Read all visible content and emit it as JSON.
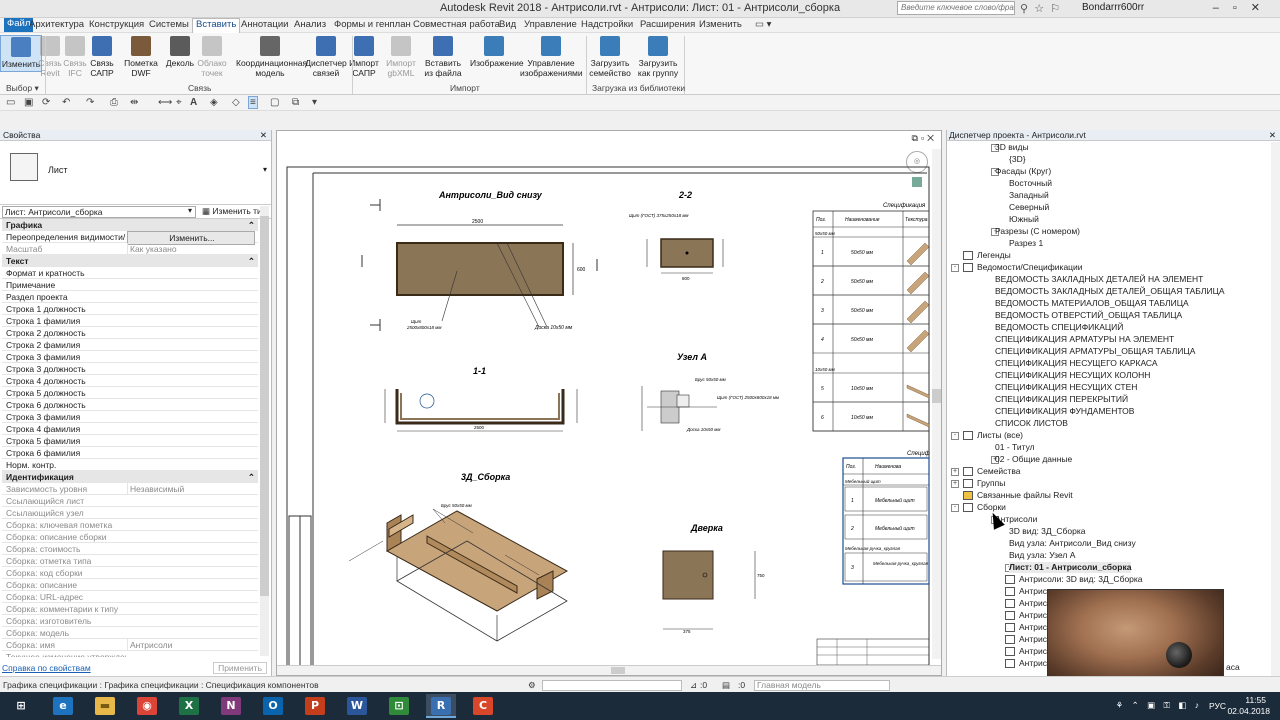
{
  "window": {
    "title": "Autodesk Revit 2018 -     Антрисоли.rvt - Антрисоли: Лист: 01 - Антрисоли_сборка",
    "search_placeholder": "Введите ключевое слово/фразу",
    "user": "Bondarrr600rr"
  },
  "menu": [
    "Файл",
    "Архитектура",
    "Конструкция",
    "Системы",
    "Вставить",
    "Аннотации",
    "Анализ",
    "Формы и генплан",
    "Совместная работа",
    "Вид",
    "Управление",
    "Надстройки",
    "Расширения",
    "Изменить"
  ],
  "menu_active": "Вставить",
  "ribbon": {
    "buttons": [
      {
        "label": "Изменить",
        "color": "#4a7fc1"
      },
      {
        "label": "Связь Revit",
        "color": "#888"
      },
      {
        "label": "Связь IFC",
        "color": "#888"
      },
      {
        "label": "Связь САПР",
        "color": "#3f6fb3"
      },
      {
        "label": "Пометка DWF",
        "color": "#7a5a3a"
      },
      {
        "label": "Деколь",
        "color": "#5b5b5b"
      },
      {
        "label": "Облако точек",
        "color": "#888"
      },
      {
        "label": "Координационная модель",
        "color": "#666"
      },
      {
        "label": "Диспетчер связей",
        "color": "#3f6fb3"
      },
      {
        "label": "Импорт САПР",
        "color": "#3f6fb3"
      },
      {
        "label": "Импорт gbXML",
        "color": "#888"
      },
      {
        "label": "Вставить из файла",
        "color": "#3f6fb3"
      },
      {
        "label": "Изображение",
        "color": "#3a7db8"
      },
      {
        "label": "Управление изображениями",
        "color": "#3a7db8"
      },
      {
        "label": "Загрузить семейство",
        "color": "#3a7db8"
      },
      {
        "label": "Загрузить как группу",
        "color": "#3a7db8"
      }
    ],
    "panels": {
      "select": "Выбор ▾",
      "link": "Связь",
      "import": "Импорт",
      "library": "Загрузка из библиотеки"
    }
  },
  "properties": {
    "header": "Свойства",
    "type_name": "Лист",
    "selector": "Лист: Антрисоли_сборка",
    "edit_type": "Изменить тип",
    "rows": [
      {
        "k": "Графика",
        "grp": true
      },
      {
        "k": "Переопределения видимости/...",
        "v": "Изменить..."
      },
      {
        "k": "Масштаб",
        "v": "Как указано",
        "dim": true
      },
      {
        "k": "Текст",
        "grp": true
      },
      {
        "k": "Формат и кратность",
        "v": ""
      },
      {
        "k": "Примечание",
        "v": ""
      },
      {
        "k": "Раздел проекта",
        "v": ""
      },
      {
        "k": "Строка 1 должность",
        "v": ""
      },
      {
        "k": "Строка 1 фамилия",
        "v": ""
      },
      {
        "k": "Строка 2 должность",
        "v": ""
      },
      {
        "k": "Строка 2 фамилия",
        "v": ""
      },
      {
        "k": "Строка 3 фамилия",
        "v": ""
      },
      {
        "k": "Строка 3 должность",
        "v": ""
      },
      {
        "k": "Строка 4 должность",
        "v": ""
      },
      {
        "k": "Строка 5 должность",
        "v": ""
      },
      {
        "k": "Строка 6 должность",
        "v": ""
      },
      {
        "k": "Строка 3 фамилия",
        "v": ""
      },
      {
        "k": "Строка 4 фамилия",
        "v": ""
      },
      {
        "k": "Строка 5 фамилия",
        "v": ""
      },
      {
        "k": "Строка 6 фамилия",
        "v": ""
      },
      {
        "k": "Норм. контр.",
        "v": ""
      },
      {
        "k": "Идентификация",
        "grp": true
      },
      {
        "k": "Зависимость уровня",
        "v": "Независимый",
        "dim": true
      },
      {
        "k": "Ссылающийся лист",
        "v": "",
        "dim": true
      },
      {
        "k": "Ссылающийся узел",
        "v": "",
        "dim": true
      },
      {
        "k": "Сборка: ключевая пометка",
        "v": "",
        "dim": true
      },
      {
        "k": "Сборка: описание сборки",
        "v": "",
        "dim": true
      },
      {
        "k": "Сборка: стоимость",
        "v": "",
        "dim": true
      },
      {
        "k": "Сборка: отметка типа",
        "v": "",
        "dim": true
      },
      {
        "k": "Сборка: код сборки",
        "v": "",
        "dim": true
      },
      {
        "k": "Сборка: описание",
        "v": "",
        "dim": true
      },
      {
        "k": "Сборка: URL-адрес",
        "v": "",
        "dim": true
      },
      {
        "k": "Сборка: комментарии к типу",
        "v": "",
        "dim": true
      },
      {
        "k": "Сборка: изготовитель",
        "v": "",
        "dim": true
      },
      {
        "k": "Сборка: модель",
        "v": "",
        "dim": true
      },
      {
        "k": "Сборка: имя",
        "v": "Антрисоли",
        "dim": true
      },
      {
        "k": "Текущее изменение утверждено",
        "v": "",
        "dim": true
      },
      {
        "k": "Текущее изменение утвердил",
        "v": "",
        "dim": true
      },
      {
        "k": "Текущее изменение утверждено",
        "v": "",
        "dim": true
      }
    ],
    "help_link": "Справка по свойствам",
    "apply": "Применить"
  },
  "drawing": {
    "title_bottom_view": "Антрисоли_Вид снизу",
    "section_22": "2-2",
    "section_11": "1-1",
    "node_a": "Узел А",
    "view_3d": "3Д_Сборка",
    "door": "Дверка",
    "spec_title": "Спецификация",
    "spec_headers": [
      "Поз.",
      "Наименование",
      "Текстура"
    ],
    "spec_group1": "50x50 мм",
    "spec_group2": "10x50 мм",
    "spec_rows1": [
      {
        "n": "1",
        "name": "50x50 мм"
      },
      {
        "n": "2",
        "name": "50x50 мм"
      },
      {
        "n": "3",
        "name": "50x50 мм"
      },
      {
        "n": "4",
        "name": "50x50 мм"
      }
    ],
    "spec_rows2": [
      {
        "n": "5",
        "name": "10x50 мм"
      },
      {
        "n": "6",
        "name": "10x50 мм"
      }
    ],
    "spec2_title": "Специф",
    "spec2_headers": [
      "Поз.",
      "Наименова"
    ],
    "spec2_group": "Мебельный щит",
    "spec2_rows": [
      {
        "n": "1",
        "name": "Мебельный щит"
      },
      {
        "n": "2",
        "name": "Мебельный щит"
      }
    ],
    "spec2_group2": "Мебельная ручка_круглая",
    "spec2_row3": {
      "n": "3",
      "name": "Мебельная ручка_круглая"
    },
    "dims": {
      "w2500": "2500",
      "h600": "600",
      "w800": "800",
      "h200": "200",
      "w375": "375",
      "h750": "750"
    },
    "notes": {
      "bar": "Брус 50х50 мм",
      "board": "Доска 10х50 мм",
      "shield": "Щит (ГОСТ) 2500х800х18 мм",
      "shield2": "Щит (ГОСТ) 375х250х18 мм",
      "c1": "Щит",
      "c2": "2500х800х18 мм"
    }
  },
  "browser": {
    "header": "Диспетчер проекта - Антрисоли.rvt",
    "items": [
      {
        "t": "3D виды",
        "lvl": 2,
        "tog": "-"
      },
      {
        "t": "{3D}",
        "lvl": 3
      },
      {
        "t": "Фасады (Круг)",
        "lvl": 2,
        "tog": "-"
      },
      {
        "t": "Восточный",
        "lvl": 3
      },
      {
        "t": "Западный",
        "lvl": 3
      },
      {
        "t": "Северный",
        "lvl": 3
      },
      {
        "t": "Южный",
        "lvl": 3
      },
      {
        "t": "Разрезы (С номером)",
        "lvl": 2,
        "tog": "-"
      },
      {
        "t": "Разрез 1",
        "lvl": 3
      },
      {
        "t": "Легенды",
        "lvl": 1,
        "icon": true
      },
      {
        "t": "Ведомости/Спецификации",
        "lvl": 1,
        "tog": "-",
        "icon": true
      },
      {
        "t": "ВЕДОМОСТЬ ЗАКЛАДНЫХ ДЕТАЛЕЙ НА ЭЛЕМЕНТ",
        "lvl": 2
      },
      {
        "t": "ВЕДОМОСТЬ ЗАКЛАДНЫХ ДЕТАЛЕЙ_ОБЩАЯ ТАБЛИЦА",
        "lvl": 2
      },
      {
        "t": "ВЕДОМОСТЬ МАТЕРИАЛОВ_ОБЩАЯ ТАБЛИЦА",
        "lvl": 2
      },
      {
        "t": "ВЕДОМОСТЬ ОТВЕРСТИЙ_ОБЩАЯ ТАБЛИЦА",
        "lvl": 2
      },
      {
        "t": "ВЕДОМОСТЬ СПЕЦИФИКАЦИЙ",
        "lvl": 2
      },
      {
        "t": "СПЕЦИФИКАЦИЯ АРМАТУРЫ НА ЭЛЕМЕНТ",
        "lvl": 2
      },
      {
        "t": "СПЕЦИФИКАЦИЯ АРМАТУРЫ_ОБЩАЯ ТАБЛИЦА",
        "lvl": 2
      },
      {
        "t": "СПЕЦИФИКАЦИЯ НЕСУЩЕГО КАРКАСА",
        "lvl": 2
      },
      {
        "t": "СПЕЦИФИКАЦИЯ НЕСУЩИХ КОЛОНН",
        "lvl": 2
      },
      {
        "t": "СПЕЦИФИКАЦИЯ НЕСУЩИХ СТЕН",
        "lvl": 2
      },
      {
        "t": "СПЕЦИФИКАЦИЯ ПЕРЕКРЫТИЙ",
        "lvl": 2
      },
      {
        "t": "СПЕЦИФИКАЦИЯ ФУНДАМЕНТОВ",
        "lvl": 2
      },
      {
        "t": "СПИСОК ЛИСТОВ",
        "lvl": 2
      },
      {
        "t": "Листы (все)",
        "lvl": 1,
        "tog": "-",
        "icon": true
      },
      {
        "t": "01 - Титул",
        "lvl": 2
      },
      {
        "t": "02 - Общие данные",
        "lvl": 2,
        "tog": "+"
      },
      {
        "t": "Семейства",
        "lvl": 1,
        "tog": "+",
        "icon": true
      },
      {
        "t": "Группы",
        "lvl": 1,
        "tog": "+",
        "icon": true
      },
      {
        "t": "Связанные файлы Revit",
        "lvl": 1,
        "icon": true
      },
      {
        "t": "Сборки",
        "lvl": 1,
        "tog": "-",
        "icon": true
      },
      {
        "t": "Антрисоли",
        "lvl": 2,
        "tog": "-"
      },
      {
        "t": "3D вид: 3Д_Сборка",
        "lvl": 3
      },
      {
        "t": "Вид узла: Антрисоли_Вид снизу",
        "lvl": 3
      },
      {
        "t": "Вид узла: Узел А",
        "lvl": 3
      },
      {
        "t": "Лист: 01 - Антрисоли_сборка",
        "lvl": 3,
        "tog": "-",
        "bold": true
      },
      {
        "t": "Антрисоли: 3D вид: 3Д_Сборка",
        "lvl": 4,
        "icon": true
      },
      {
        "t": "Антрисо",
        "lvl": 4,
        "icon": true
      },
      {
        "t": "Антрисо",
        "lvl": 4,
        "icon": true
      },
      {
        "t": "Антрисо",
        "lvl": 4,
        "icon": true
      },
      {
        "t": "Антрисо",
        "lvl": 4,
        "icon": true
      },
      {
        "t": "Антрисо",
        "lvl": 4,
        "icon": true
      },
      {
        "t": "Антрисо",
        "lvl": 4,
        "icon": true
      },
      {
        "t": "Антрисо",
        "lvl": 4,
        "icon": true
      }
    ],
    "trailing": "аса"
  },
  "status": {
    "left": "Графика спецификации : Графика спецификации : Спецификация компонентов",
    "zero": ":0",
    "model": "Главная модель"
  },
  "taskbar": {
    "lang": "РУС",
    "time": "11:55",
    "date": "02.04.2018"
  }
}
